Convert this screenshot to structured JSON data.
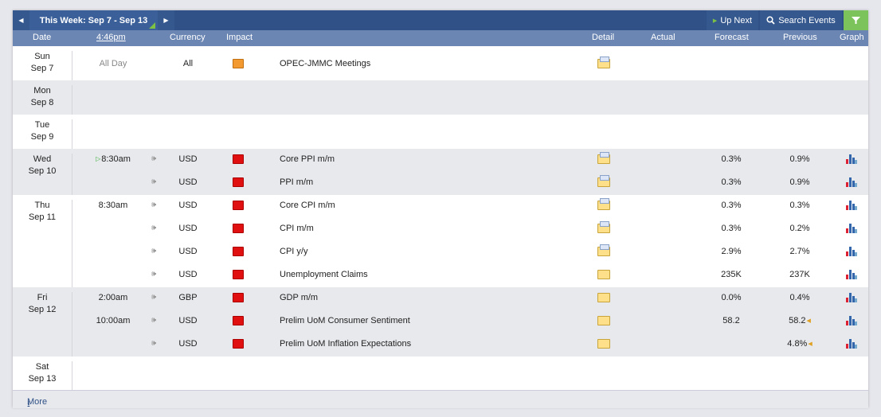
{
  "toolbar": {
    "prev_icon": "triangle-left",
    "next_icon": "triangle-right",
    "week_title": "This Week: Sep 7 - Sep 13",
    "up_next": "Up Next",
    "search": "Search Events",
    "filter_icon": "funnel"
  },
  "columns": {
    "date": "Date",
    "time": "4:46pm",
    "currency": "Currency",
    "impact": "Impact",
    "detail": "Detail",
    "actual": "Actual",
    "forecast": "Forecast",
    "previous": "Previous",
    "graph": "Graph"
  },
  "days": [
    {
      "dow": "Sun",
      "date": "Sep 7"
    },
    {
      "dow": "Mon",
      "date": "Sep 8"
    },
    {
      "dow": "Tue",
      "date": "Sep 9"
    },
    {
      "dow": "Wed",
      "date": "Sep 10"
    },
    {
      "dow": "Thu",
      "date": "Sep 11"
    },
    {
      "dow": "Fri",
      "date": "Sep 12"
    },
    {
      "dow": "Sat",
      "date": "Sep 13"
    }
  ],
  "events": [
    {
      "time": "All Day",
      "currency": "All",
      "impact": "orange",
      "name": "OPEC-JMMC Meetings",
      "forecast": "",
      "previous": "",
      "speaker": false,
      "graph": false
    },
    {
      "time": "8:30am",
      "currency": "USD",
      "impact": "red",
      "name": "Core PPI m/m",
      "forecast": "0.3%",
      "previous": "0.9%",
      "speaker": true,
      "graph": true
    },
    {
      "time": "",
      "currency": "USD",
      "impact": "red",
      "name": "PPI m/m",
      "forecast": "0.3%",
      "previous": "0.9%",
      "speaker": true,
      "graph": true
    },
    {
      "time": "8:30am",
      "currency": "USD",
      "impact": "red",
      "name": "Core CPI m/m",
      "forecast": "0.3%",
      "previous": "0.3%",
      "speaker": true,
      "graph": true
    },
    {
      "time": "",
      "currency": "USD",
      "impact": "red",
      "name": "CPI m/m",
      "forecast": "0.3%",
      "previous": "0.2%",
      "speaker": true,
      "graph": true
    },
    {
      "time": "",
      "currency": "USD",
      "impact": "red",
      "name": "CPI y/y",
      "forecast": "2.9%",
      "previous": "2.7%",
      "speaker": true,
      "graph": true
    },
    {
      "time": "",
      "currency": "USD",
      "impact": "red",
      "name": "Unemployment Claims",
      "forecast": "235K",
      "previous": "237K",
      "speaker": true,
      "graph": true
    },
    {
      "time": "2:00am",
      "currency": "GBP",
      "impact": "red",
      "name": "GDP m/m",
      "forecast": "0.0%",
      "previous": "0.4%",
      "speaker": true,
      "graph": true
    },
    {
      "time": "10:00am",
      "currency": "USD",
      "impact": "red",
      "name": "Prelim UoM Consumer Sentiment",
      "forecast": "58.2",
      "previous": "58.2",
      "speaker": true,
      "graph": true
    },
    {
      "time": "",
      "currency": "USD",
      "impact": "red",
      "name": "Prelim UoM Inflation Expectations",
      "forecast": "",
      "previous": "4.8%",
      "speaker": true,
      "graph": true
    }
  ],
  "more": "More",
  "colors": {
    "toolbar": "#2f5187",
    "header": "#6b86b3",
    "high_impact": "#e01010",
    "medium_impact": "#f29a2f",
    "filter": "#7dc35b"
  }
}
